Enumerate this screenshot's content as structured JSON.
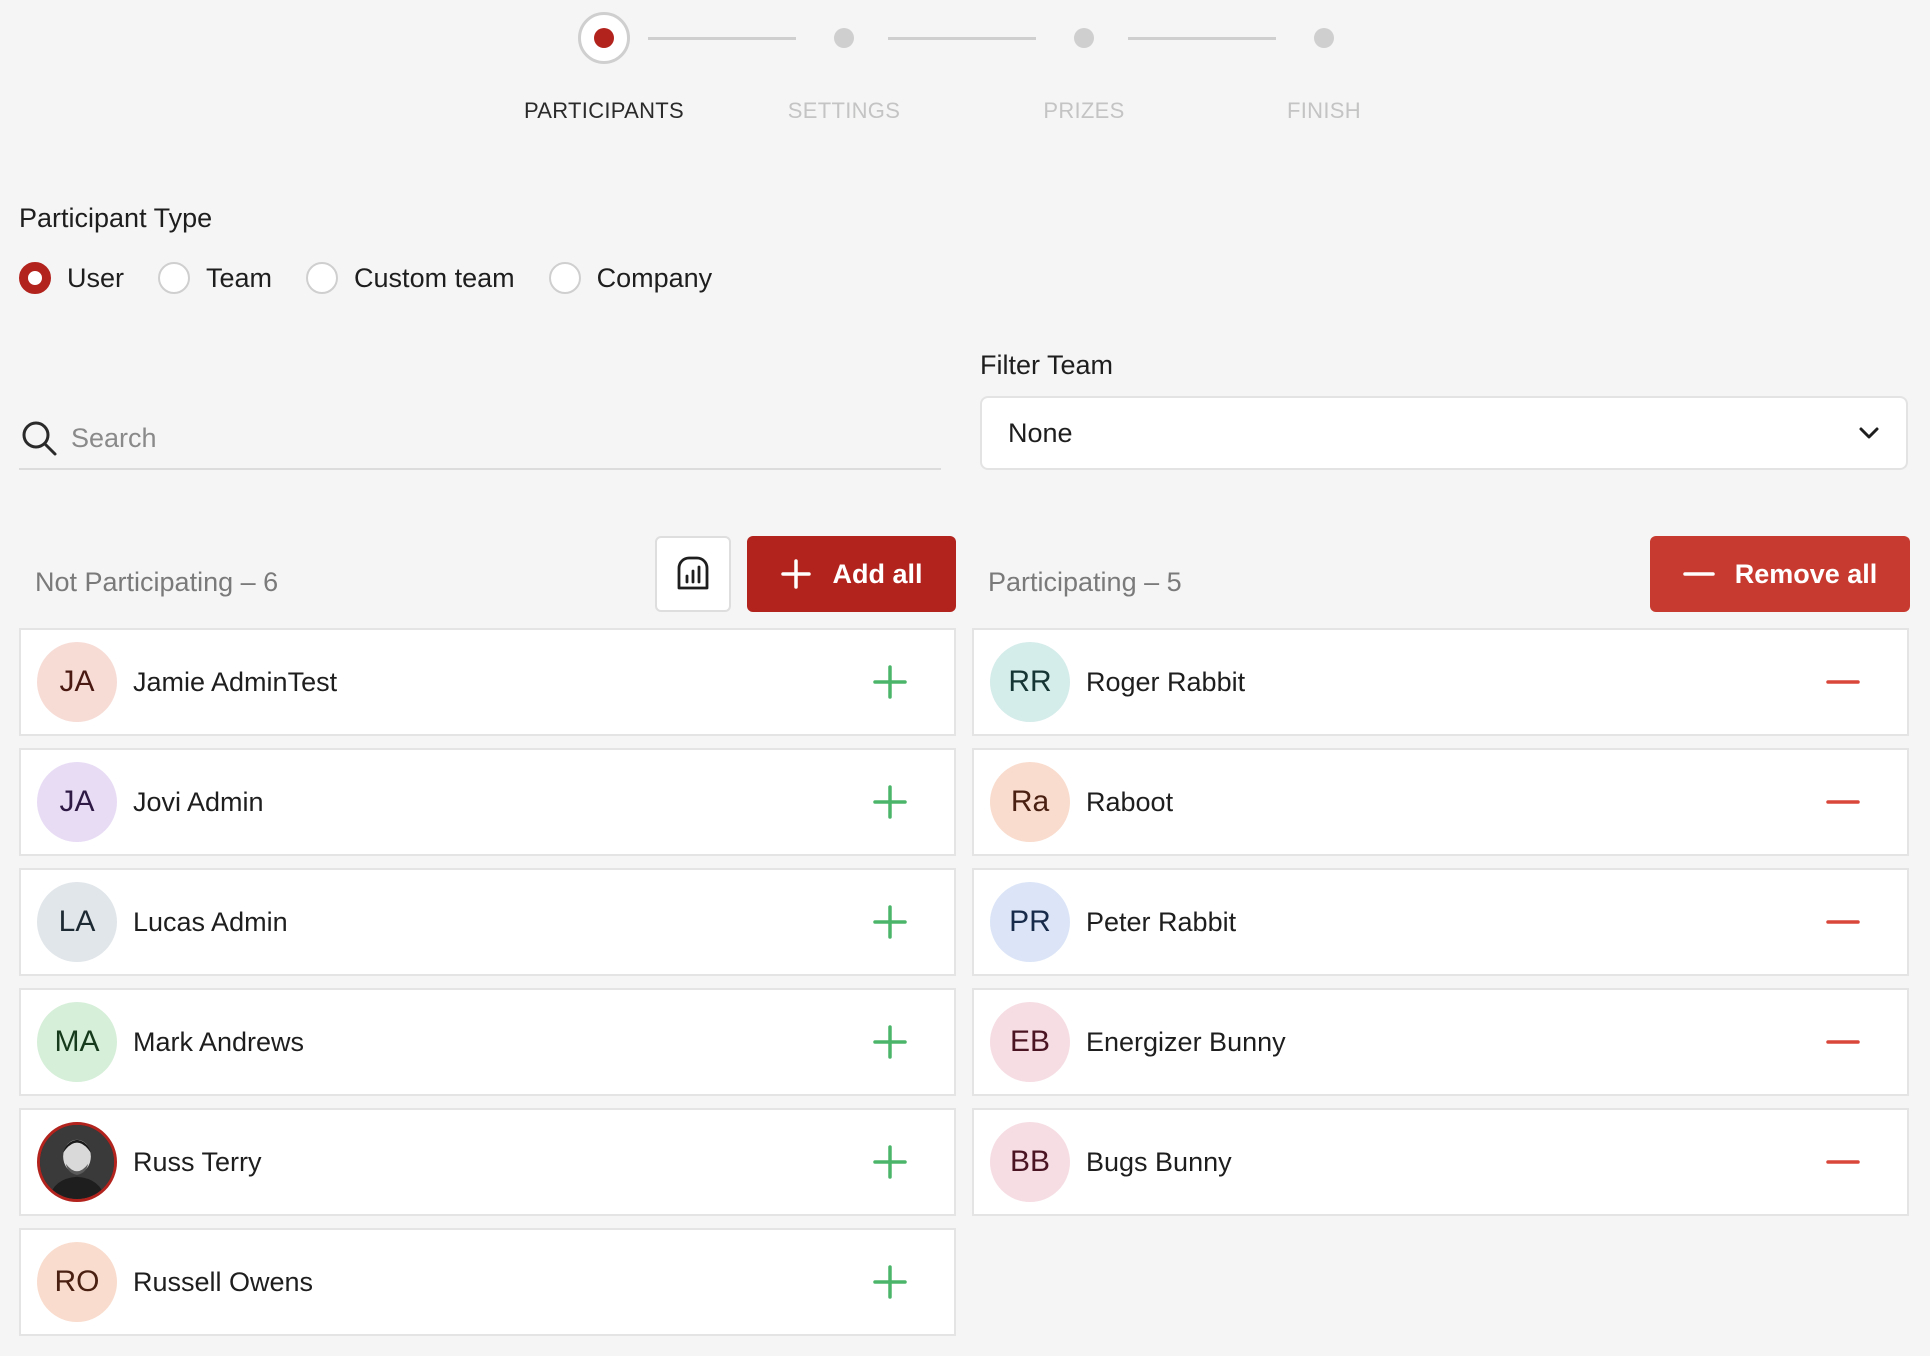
{
  "stepper": {
    "steps": [
      {
        "label": "PARTICIPANTS",
        "active": true
      },
      {
        "label": "SETTINGS",
        "active": false
      },
      {
        "label": "PRIZES",
        "active": false
      },
      {
        "label": "FINISH",
        "active": false
      }
    ]
  },
  "participant_type": {
    "title": "Participant Type",
    "options": [
      "User",
      "Team",
      "Custom team",
      "Company"
    ],
    "selected": "User"
  },
  "search": {
    "placeholder": "Search",
    "value": ""
  },
  "filter": {
    "label": "Filter Team",
    "value": "None"
  },
  "not_participating": {
    "header": "Not Participating – 6",
    "add_all_label": "Add all",
    "items": [
      {
        "initials": "JA",
        "name": "Jamie AdminTest",
        "bg": "#f7dcd6",
        "fg": "#4a1a12"
      },
      {
        "initials": "JA",
        "name": "Jovi Admin",
        "bg": "#e8dcf5",
        "fg": "#2e1a45"
      },
      {
        "initials": "LA",
        "name": "Lucas Admin",
        "bg": "#e1e6ea",
        "fg": "#1e2a33"
      },
      {
        "initials": "MA",
        "name": "Mark Andrews",
        "bg": "#d6efd9",
        "fg": "#163a1c"
      },
      {
        "initials": "",
        "name": "Russ Terry",
        "bg": "#2b2b2b",
        "fg": "#ffffff",
        "photo": true
      },
      {
        "initials": "RO",
        "name": "Russell Owens",
        "bg": "#f9dccd",
        "fg": "#4a2012"
      }
    ]
  },
  "participating": {
    "header": "Participating – 5",
    "remove_all_label": "Remove all",
    "items": [
      {
        "initials": "RR",
        "name": "Roger Rabbit",
        "bg": "#d4ecea",
        "fg": "#143533"
      },
      {
        "initials": "Ra",
        "name": "Raboot",
        "bg": "#f9dccd",
        "fg": "#4a2012"
      },
      {
        "initials": "PR",
        "name": "Peter Rabbit",
        "bg": "#dbe5f7",
        "fg": "#172a4a"
      },
      {
        "initials": "EB",
        "name": "Energizer Bunny",
        "bg": "#f6dde3",
        "fg": "#4a1422"
      },
      {
        "initials": "BB",
        "name": "Bugs Bunny",
        "bg": "#f6dde3",
        "fg": "#4a1422"
      }
    ]
  },
  "colors": {
    "accent": "#b3231e",
    "add_icon": "#4bb56a",
    "remove_icon": "#d9473a"
  }
}
